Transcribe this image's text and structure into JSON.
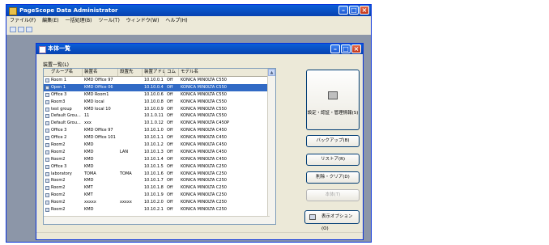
{
  "app": {
    "title": "PageScope Data Administrator",
    "menu": [
      "ファイル(F)",
      "編集(E)",
      "一括処理(B)",
      "ツール(T)",
      "ウィンドウ(W)",
      "ヘルプ(H)"
    ]
  },
  "child_window": {
    "title": "本体一覧",
    "group_label": "装置一覧(L)"
  },
  "list": {
    "columns": [
      "グループ名",
      "装置名",
      "設置先",
      "装置アドレス",
      "コム",
      "モデル名"
    ],
    "selected_index": 1,
    "rows": [
      [
        "Room 1",
        "KMD Office 97",
        "",
        "10.10.0.1",
        "Off",
        "KONICA MINOLTA C550"
      ],
      [
        "Open 1",
        "KMD Office 06",
        "",
        "10.10.0.4",
        "Off",
        "KONICA MINOLTA C550"
      ],
      [
        "Office 3",
        "KMD Room1",
        "",
        "10.10.0.6",
        "Off",
        "KONICA MINOLTA C550"
      ],
      [
        "Room3",
        "KMD local",
        "",
        "10.10.0.8",
        "Off",
        "KONICA MINOLTA C550"
      ],
      [
        "test group",
        "KMD local 10",
        "",
        "10.10.0.9",
        "Off",
        "KONICA MINOLTA C550"
      ],
      [
        "Default Grou...",
        "11",
        "",
        "10.1.0.11",
        "Off",
        "KONICA MINOLTA C550"
      ],
      [
        "Default Grou...",
        "xxx",
        "",
        "10.1.0.12",
        "Off",
        "KONICA MINOLTA C450P"
      ],
      [
        "Office 3",
        "KMD Office 97",
        "",
        "10.10.1.0",
        "Off",
        "KONICA MINOLTA C450"
      ],
      [
        "Office 2",
        "KMD Office 101",
        "",
        "10.10.1.1",
        "Off",
        "KONICA MINOLTA C450"
      ],
      [
        "Room2",
        "KMD",
        "",
        "10.10.1.2",
        "Off",
        "KONICA MINOLTA C450"
      ],
      [
        "Room2",
        "KMD",
        "LAN",
        "10.10.1.3",
        "Off",
        "KONICA MINOLTA C450"
      ],
      [
        "Room2",
        "KMD",
        "",
        "10.10.1.4",
        "Off",
        "KONICA MINOLTA C450"
      ],
      [
        "Office 3",
        "KMD",
        "",
        "10.10.1.5",
        "Off",
        "KONICA MINOLTA C250"
      ],
      [
        "laboratory",
        "TOMA",
        "TOMA",
        "10.10.1.6",
        "Off",
        "KONICA MINOLTA C250"
      ],
      [
        "Room2",
        "KMD",
        "",
        "10.10.1.7",
        "Off",
        "KONICA MINOLTA C250"
      ],
      [
        "Room2",
        "KMT",
        "",
        "10.10.1.8",
        "Off",
        "KONICA MINOLTA C250"
      ],
      [
        "Room2",
        "KMT",
        "",
        "10.10.1.9",
        "Off",
        "KONICA MINOLTA C250"
      ],
      [
        "Room2",
        "xxxxx",
        "xxxxx",
        "10.10.2.0",
        "Off",
        "KONICA MINOLTA C250"
      ],
      [
        "Room2",
        "KMD",
        "",
        "10.10.2.1",
        "Off",
        "KONICA MINOLTA C250"
      ]
    ]
  },
  "buttons": {
    "settings": "設定・認証・管理情報(S)",
    "backup": "バックアップ(B)",
    "restore": "リストア(R)",
    "delete": "削除・クリア(D)",
    "disabled": "本体(T)",
    "display_options": "表示オプション(O)"
  },
  "icons": {
    "app": "app-icon",
    "printer": "printer-icon",
    "display": "display-options-icon"
  }
}
